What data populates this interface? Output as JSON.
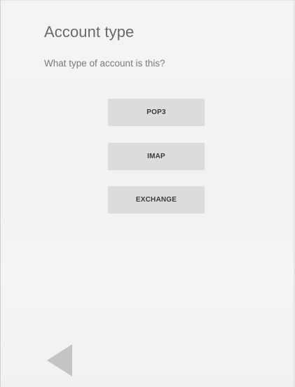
{
  "page": {
    "title": "Account type",
    "subtitle": "What type of account is this?"
  },
  "options": {
    "pop3": "POP3",
    "imap": "IMAP",
    "exchange": "EXCHANGE"
  },
  "navigation": {
    "back_icon": "back-triangle-icon"
  },
  "colors": {
    "background": "#f3f3f3",
    "button": "#dcdcdc",
    "button_text": "#3a3a3a",
    "title_text": "#6a6a6a",
    "icon": "#c4c4c4"
  }
}
